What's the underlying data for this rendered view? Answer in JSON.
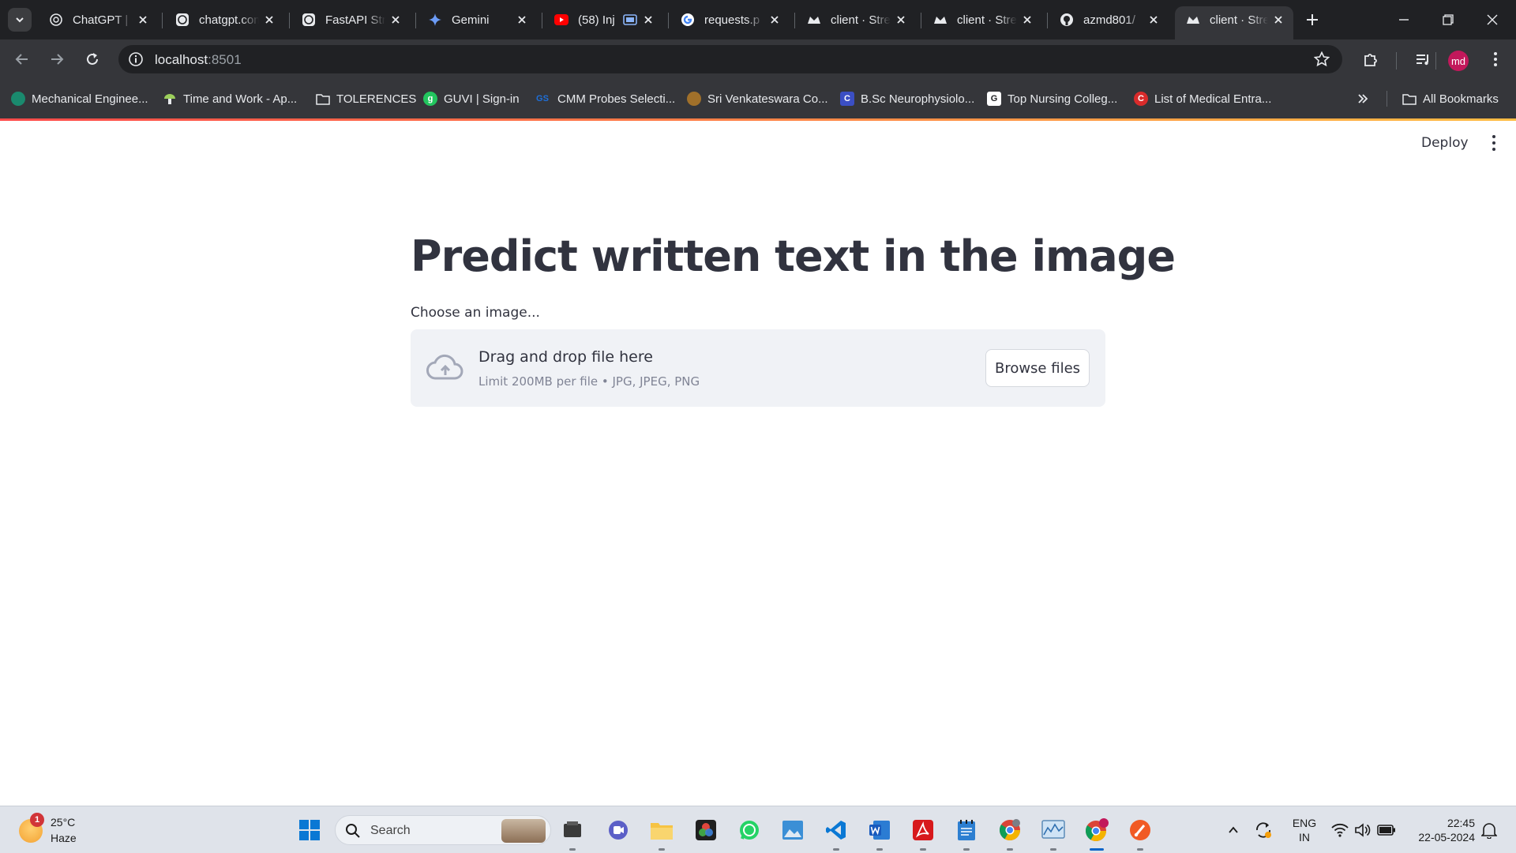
{
  "browser": {
    "tabs": [
      {
        "title": "ChatGPT | C",
        "favicon": "openai-icon"
      },
      {
        "title": "chatgpt.com",
        "favicon": "openai-icon"
      },
      {
        "title": "FastAPI Str",
        "favicon": "openai-icon"
      },
      {
        "title": "Gemini",
        "favicon": "gemini-icon"
      },
      {
        "title": "(58) Inj",
        "favicon": "youtube-icon"
      },
      {
        "title": "requests.p",
        "favicon": "google-icon"
      },
      {
        "title": "client · Stre",
        "favicon": "streamlit-icon"
      },
      {
        "title": "client · Stre",
        "favicon": "streamlit-icon"
      },
      {
        "title": "azmd801/",
        "favicon": "github-icon"
      },
      {
        "title": "client · Stre",
        "favicon": "streamlit-icon",
        "active": true
      }
    ],
    "url_host": "localhost",
    "url_port": ":8501",
    "profile_initials": "md",
    "bookmarks": [
      {
        "label": "Mechanical Enginee...",
        "favicon_color": "#1a8a6e",
        "glyph": ""
      },
      {
        "label": "Time and Work - Ap...",
        "favicon_color": "#9ccf5b",
        "glyph": ""
      },
      {
        "label": "TOLERENCES",
        "favicon_color": "folder",
        "glyph": ""
      },
      {
        "label": "GUVI | Sign-in",
        "favicon_color": "#22c55e",
        "glyph": "g"
      },
      {
        "label": "CMM Probes Selecti...",
        "favicon_color": "#1e6fd9",
        "glyph": "GS"
      },
      {
        "label": "Sri Venkateswara Co...",
        "favicon_color": "#a0702a",
        "glyph": ""
      },
      {
        "label": "B.Sc Neurophysiolo...",
        "favicon_color": "#3b4fc4",
        "glyph": "C"
      },
      {
        "label": "Top Nursing Colleg...",
        "favicon_color": "#ffffff",
        "glyph": "G"
      },
      {
        "label": "List of Medical Entra...",
        "favicon_color": "#d92b2b",
        "glyph": "C"
      }
    ],
    "all_bookmarks_label": "All Bookmarks",
    "accent_colors": [
      "#ff4b4b",
      "#ffbd45"
    ]
  },
  "app": {
    "deploy_label": "Deploy",
    "title": "Predict written text in the image",
    "uploader_label": "Choose an image...",
    "dropzone_main": "Drag and drop file here",
    "dropzone_limit": "Limit 200MB per file • JPG, JPEG, PNG",
    "browse_label": "Browse files"
  },
  "taskbar": {
    "weather_temp": "25°C",
    "weather_condition": "Haze",
    "weather_badge": "1",
    "search_placeholder": "Search",
    "lang_line1": "ENG",
    "lang_line2": "IN",
    "time": "22:45",
    "date": "22-05-2024",
    "apps": [
      "windows-start-icon",
      "file-viewer-icon",
      "teams-icon",
      "file-explorer-icon",
      "davinci-icon",
      "whatsapp-icon",
      "image-viewer-icon",
      "vscode-icon",
      "word-icon",
      "acrobat-icon",
      "notepad-icon",
      "chrome-icon",
      "monitor-icon",
      "chrome-profile-icon",
      "brush-icon"
    ]
  }
}
